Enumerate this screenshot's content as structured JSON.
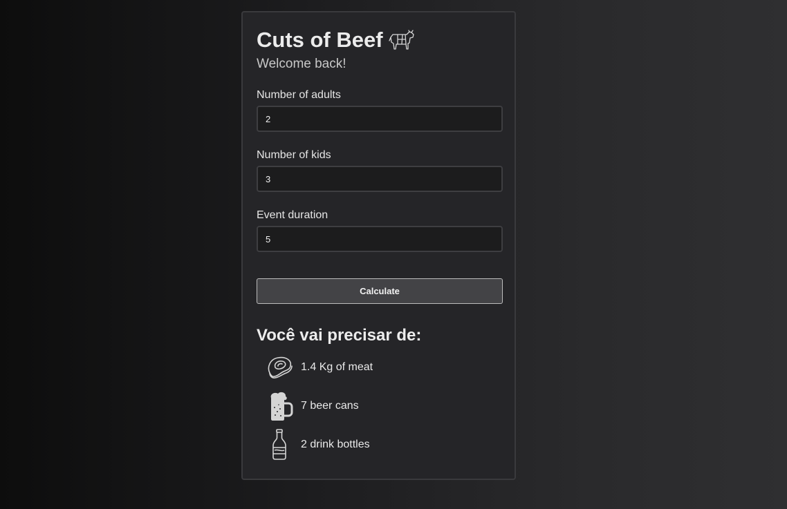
{
  "header": {
    "title": "Cuts of Beef",
    "subtitle": "Welcome back!"
  },
  "form": {
    "adults": {
      "label": "Number of adults",
      "value": "2"
    },
    "kids": {
      "label": "Number of kids",
      "value": "3"
    },
    "duration": {
      "label": "Event duration",
      "value": "5"
    },
    "submit_label": "Calculate"
  },
  "results": {
    "title": "Você vai precisar de:",
    "items": [
      {
        "icon": "steak-icon",
        "text": "1.4 Kg of meat"
      },
      {
        "icon": "beer-mug-icon",
        "text": "7 beer cans"
      },
      {
        "icon": "soda-bottle-icon",
        "text": "2 drink bottles"
      }
    ]
  },
  "colors": {
    "card_bg": "#252528",
    "input_bg": "#1c1c1d",
    "button_bg": "#434346",
    "text": "#ececec"
  }
}
